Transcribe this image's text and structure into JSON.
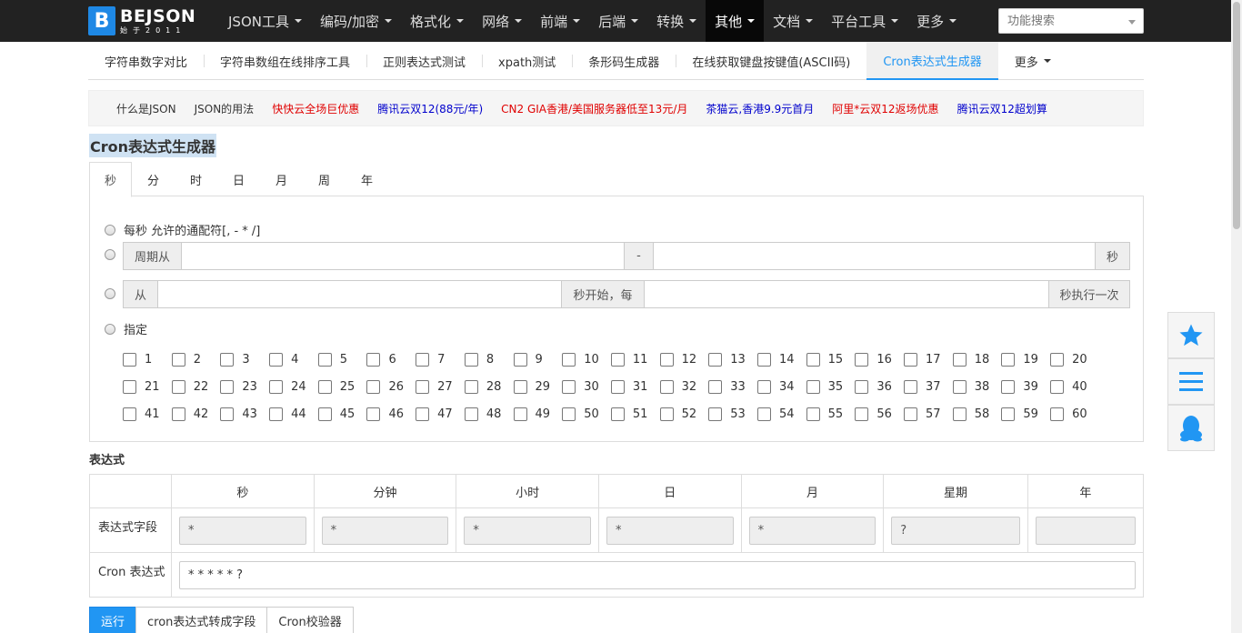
{
  "brand": {
    "letter": "B",
    "name": "BEJSON",
    "sub": "始于2011"
  },
  "topnav": [
    {
      "label": "JSON工具",
      "name": "json"
    },
    {
      "label": "编码/加密",
      "name": "encode"
    },
    {
      "label": "格式化",
      "name": "format"
    },
    {
      "label": "网络",
      "name": "network"
    },
    {
      "label": "前端",
      "name": "frontend"
    },
    {
      "label": "后端",
      "name": "backend"
    },
    {
      "label": "转换",
      "name": "convert"
    },
    {
      "label": "其他",
      "name": "other"
    },
    {
      "label": "文档",
      "name": "docs"
    },
    {
      "label": "平台工具",
      "name": "platform"
    },
    {
      "label": "更多",
      "name": "more"
    }
  ],
  "search": {
    "placeholder": "功能搜索"
  },
  "subnav": [
    {
      "label": "字符串数字对比"
    },
    {
      "label": "字符串数组在线排序工具"
    },
    {
      "label": "正则表达式测试"
    },
    {
      "label": "xpath测试"
    },
    {
      "label": "条形码生成器"
    },
    {
      "label": "在线获取键盘按键值(ASCII码)"
    },
    {
      "label": "Cron表达式生成器"
    },
    {
      "label": "更多"
    }
  ],
  "promo": [
    {
      "label": "什么是JSON",
      "color": "#333333"
    },
    {
      "label": "JSON的用法",
      "color": "#333333"
    },
    {
      "label": "快快云全场巨优惠",
      "color": "#e00000"
    },
    {
      "label": "腾讯云双12(88元/年)",
      "color": "#0000cc"
    },
    {
      "label": "CN2 GIA香港/美国服务器低至13元/月",
      "color": "#e00000"
    },
    {
      "label": "茶猫云,香港9.9元首月",
      "color": "#0000cc"
    },
    {
      "label": "阿里*云双12返场优惠",
      "color": "#e00000"
    },
    {
      "label": "腾讯云双12超划算",
      "color": "#0000cc"
    }
  ],
  "page_title": "Cron表达式生成器",
  "tabs": [
    "秒",
    "分",
    "时",
    "日",
    "月",
    "周",
    "年"
  ],
  "panel": {
    "opt_every": "每秒 允许的通配符[, - * /]",
    "opt_cycle_prefix": "周期从",
    "opt_cycle_sep": "-",
    "opt_cycle_suffix": "秒",
    "opt_from_prefix": "从",
    "opt_from_mid": "秒开始，每",
    "opt_from_suffix": "秒执行一次",
    "opt_specify": "指定"
  },
  "expr": {
    "title": "表达式",
    "headers": [
      "秒",
      "分钟",
      "小时",
      "日",
      "月",
      "星期",
      "年"
    ],
    "row1_label": "表达式字段",
    "fields": [
      "*",
      "*",
      "*",
      "*",
      "*",
      "?",
      ""
    ],
    "row2_label": "Cron 表达式",
    "cron": "* * * * * ?"
  },
  "buttons": {
    "run": "运行",
    "to_fields": "cron表达式转成字段",
    "validator": "Cron校验器"
  },
  "colors": {
    "accent": "#2196f3",
    "nav_bg": "#222222"
  }
}
